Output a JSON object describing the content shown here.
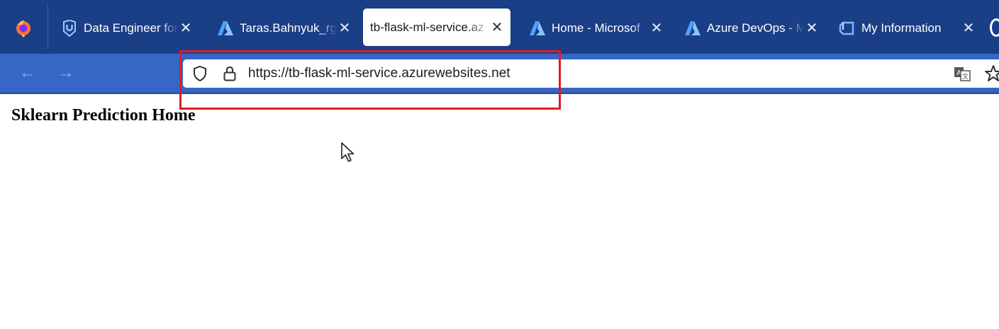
{
  "browser": {
    "tabs": [
      {
        "title": "Data Engineer for",
        "icon": "udacity-icon",
        "active": false
      },
      {
        "title": "Taras.Bahnyuk_rg",
        "icon": "azure-icon",
        "active": false
      },
      {
        "title": "tb-flask-ml-service.az",
        "icon": "none",
        "active": true
      },
      {
        "title": "Home - Microsof",
        "icon": "azure-icon",
        "active": false
      },
      {
        "title": "Azure DevOps - M",
        "icon": "azure-icon",
        "active": false
      },
      {
        "title": "My Information",
        "icon": "cloud-shell-icon",
        "active": false
      }
    ],
    "close_glyph": "✕",
    "nav": {
      "back_glyph": "←",
      "forward_glyph": "→"
    },
    "address_bar": {
      "url": "https://tb-flask-ml-service.azurewebsites.net"
    },
    "colors": {
      "tab_strip": "#1b3f86",
      "nav_bar": "#3567c6",
      "highlight": "#e11b22"
    }
  },
  "page": {
    "heading": "Sklearn Prediction Home"
  }
}
